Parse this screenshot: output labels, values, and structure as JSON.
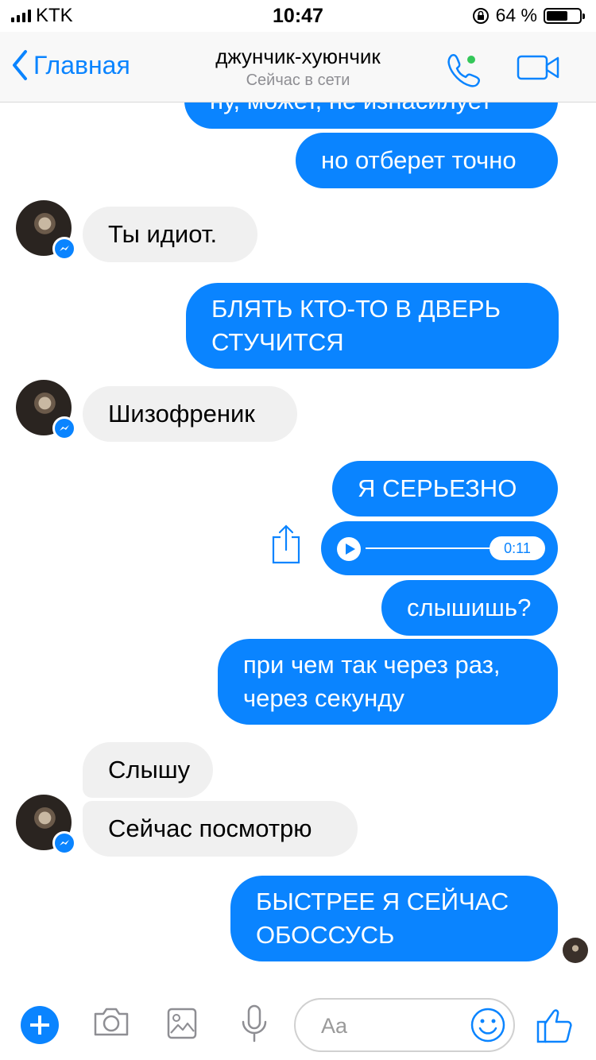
{
  "status_bar": {
    "carrier": "KTK",
    "time": "10:47",
    "battery": "64 %",
    "battery_level": 0.64
  },
  "nav": {
    "back_label": "Главная",
    "title": "джунчик-хуюнчик",
    "subtitle": "Сейчас в сети"
  },
  "messages": [
    {
      "from": "me",
      "text": "ну, может, не изнасилует"
    },
    {
      "from": "me",
      "text": "но отберет точно"
    },
    {
      "from": "them",
      "text": "Ты идиот."
    },
    {
      "from": "me",
      "text": "БЛЯТЬ КТО-ТО В ДВЕРЬ СТУЧИТСЯ"
    },
    {
      "from": "them",
      "text": "Шизофреник"
    },
    {
      "from": "me",
      "text": "Я СЕРЬЕЗНО"
    },
    {
      "from": "me",
      "type": "audio",
      "duration": "0:11"
    },
    {
      "from": "me",
      "text": "слышишь?"
    },
    {
      "from": "me",
      "text": "при чем так через раз, через секунду"
    },
    {
      "from": "them",
      "text": "Слышу"
    },
    {
      "from": "them",
      "text": "Сейчас посмотрю"
    },
    {
      "from": "me",
      "text": "БЫСТРЕЕ Я СЕЙЧАС ОБОССУСЬ"
    }
  ],
  "composer": {
    "placeholder": "Aa"
  },
  "colors": {
    "accent": "#0a84ff",
    "incoming_bubble": "#f0f0f0",
    "online_dot": "#34c759"
  }
}
